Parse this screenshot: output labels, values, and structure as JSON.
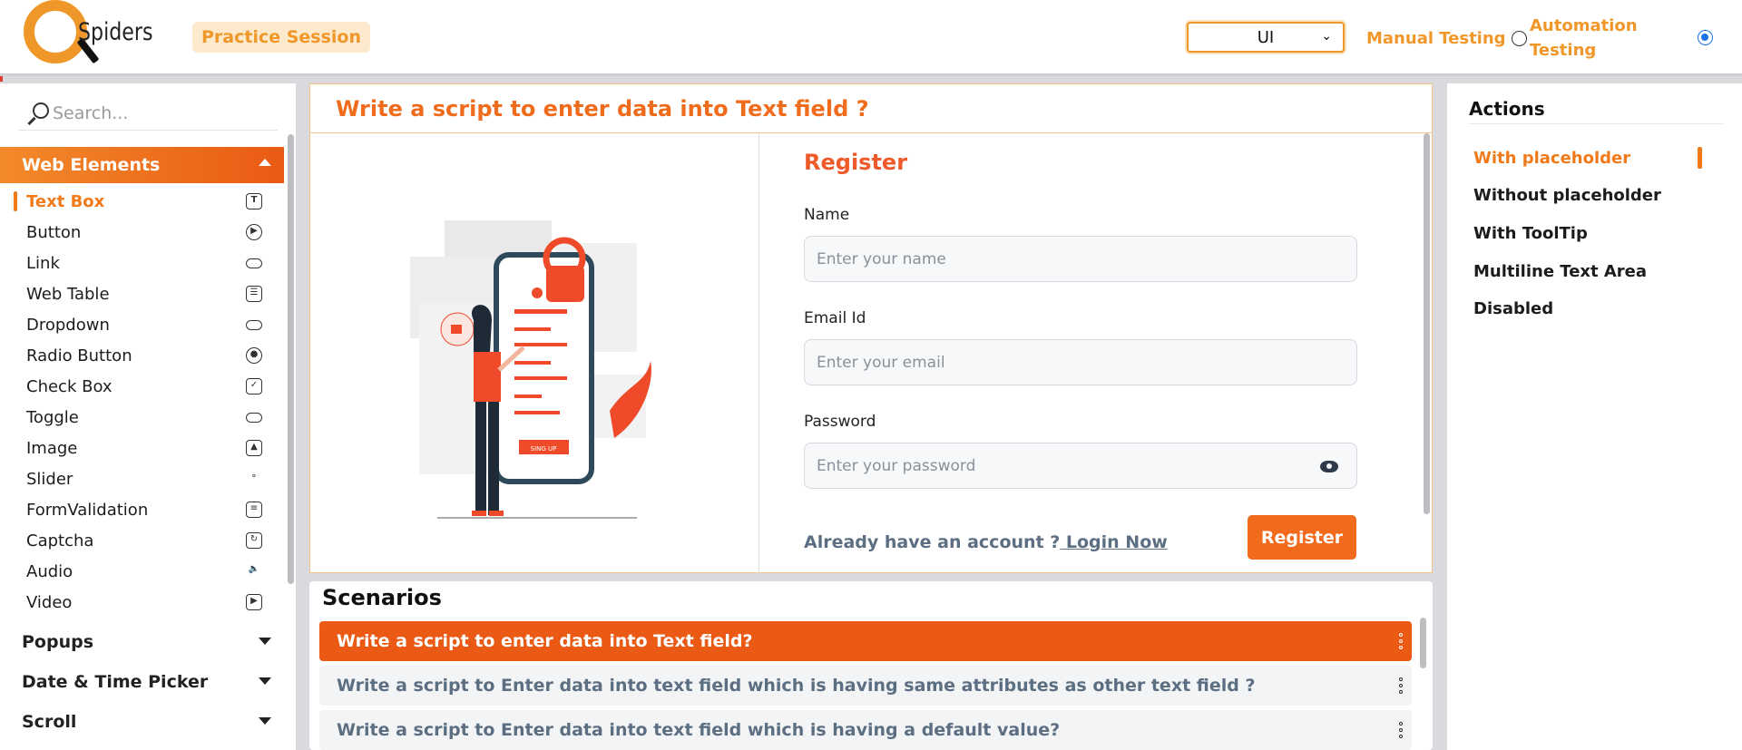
{
  "header": {
    "logo_text": "Spiders",
    "practice_label": "Practice Session",
    "mode_select": "UI",
    "radio_manual": "Manual Testing",
    "radio_automation_line1": "Automation",
    "radio_automation_line2": "Testing",
    "automation_checked": true
  },
  "sidebar": {
    "search_placeholder": "Search...",
    "sections": [
      {
        "label": "Web Elements",
        "expanded": true
      },
      {
        "label": "Popups",
        "expanded": false
      },
      {
        "label": "Date & Time Picker",
        "expanded": false
      },
      {
        "label": "Scroll",
        "expanded": false
      }
    ],
    "items": [
      {
        "label": "Text Box",
        "icon": "textbox-icon",
        "active": true
      },
      {
        "label": "Button",
        "icon": "play-button-icon"
      },
      {
        "label": "Link",
        "icon": "link-icon"
      },
      {
        "label": "Web Table",
        "icon": "table-icon"
      },
      {
        "label": "Dropdown",
        "icon": "dropdown-icon"
      },
      {
        "label": "Radio Button",
        "icon": "radio-icon"
      },
      {
        "label": "Check Box",
        "icon": "checkbox-icon"
      },
      {
        "label": "Toggle",
        "icon": "toggle-icon"
      },
      {
        "label": "Image",
        "icon": "image-icon"
      },
      {
        "label": "Slider",
        "icon": "slider-icon"
      },
      {
        "label": "FormValidation",
        "icon": "form-icon"
      },
      {
        "label": "Captcha",
        "icon": "captcha-icon"
      },
      {
        "label": "Audio",
        "icon": "audio-icon"
      },
      {
        "label": "Video",
        "icon": "video-icon"
      }
    ]
  },
  "main": {
    "title": "Write a script to enter data into Text field ?",
    "form": {
      "heading": "Register",
      "name_label": "Name",
      "name_placeholder": "Enter your name",
      "email_label": "Email Id",
      "email_placeholder": "Enter your email",
      "password_label": "Password",
      "password_placeholder": "Enter your password",
      "account_text": "Already have an account ?",
      "login_link": " Login Now",
      "register_button": "Register"
    },
    "illustration": {
      "button_text": "SING UP"
    }
  },
  "scenarios": {
    "title": "Scenarios",
    "rows": [
      {
        "text": "Write a script to enter data into Text field?",
        "active": true
      },
      {
        "text": "Write a script to Enter data into text field which is having same attributes as other text field ?"
      },
      {
        "text": "Write a script to Enter data into text field which is having a default value?"
      }
    ]
  },
  "actions": {
    "title": "Actions",
    "items": [
      {
        "label": "With placeholder",
        "active": true
      },
      {
        "label": "Without placeholder"
      },
      {
        "label": "With ToolTip"
      },
      {
        "label": "Multiline Text Area"
      },
      {
        "label": "Disabled"
      }
    ]
  },
  "colors": {
    "accent": "#ef6c1d",
    "brand_orange": "#f0972a",
    "radio_blue": "#1a73e8"
  }
}
